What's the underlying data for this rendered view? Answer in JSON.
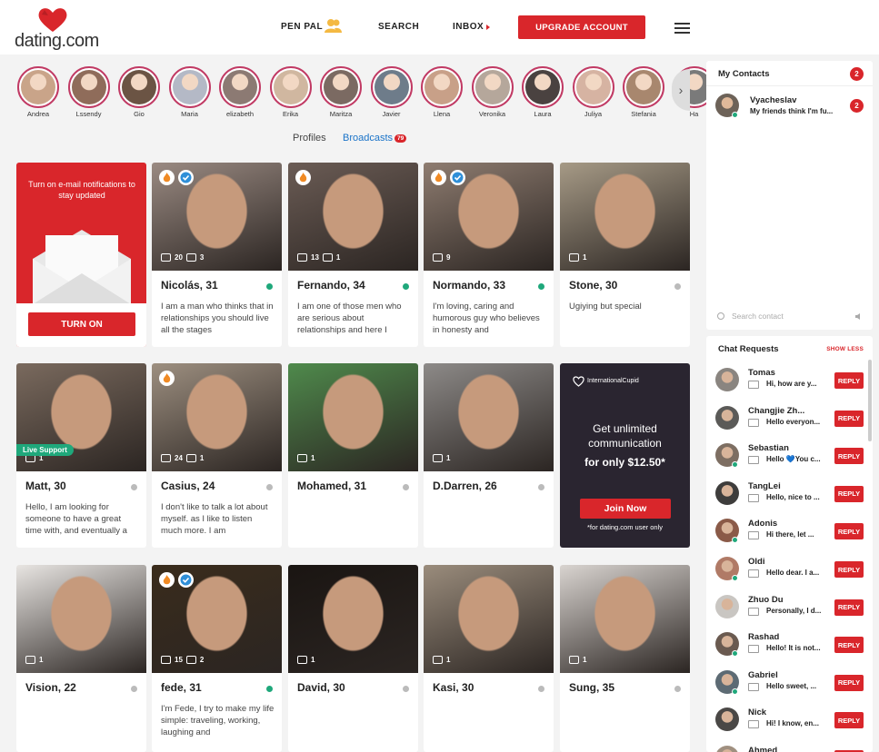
{
  "header": {
    "logo_text": "dating.com",
    "nav": {
      "penpal": "PEN PAL",
      "search": "SEARCH",
      "inbox": "INBOX"
    },
    "upgrade_label": "UPGRADE ACCOUNT"
  },
  "stories": [
    {
      "name": "Andrea",
      "color": "#c9a489"
    },
    {
      "name": "Lssendy",
      "color": "#8f6c5a"
    },
    {
      "name": "Gio",
      "color": "#6b5444"
    },
    {
      "name": "Maria",
      "color": "#b4b9c6"
    },
    {
      "name": "elizabeth",
      "color": "#8c7a73"
    },
    {
      "name": "Erika",
      "color": "#d0b7a0"
    },
    {
      "name": "Maritza",
      "color": "#7b6a62"
    },
    {
      "name": "Javier",
      "color": "#6e7c8a"
    },
    {
      "name": "Llena",
      "color": "#c8a088"
    },
    {
      "name": "Veronika",
      "color": "#b5a79b"
    },
    {
      "name": "Laura",
      "color": "#4a4240"
    },
    {
      "name": "Juliya",
      "color": "#d6b3a2"
    },
    {
      "name": "Stefania",
      "color": "#a8876e"
    },
    {
      "name": "Ha",
      "color": "#7a7a7a"
    }
  ],
  "tabs": {
    "profiles": "Profiles",
    "broadcasts": "Broadcasts",
    "broadcasts_count": "79"
  },
  "notify_card": {
    "text": "Turn on e-mail notifications to stay updated",
    "button": "TURN ON"
  },
  "promo_card": {
    "brand": "InternationalCupid",
    "line1": "Get unlimited communication",
    "line2": "for only $12.50*",
    "button": "Join Now",
    "footnote": "*for dating.com user only"
  },
  "live_support": "Live Support",
  "profiles": [
    {
      "name": "Nicolás, 31",
      "bio": "I am a man who thinks that in relationships you should live all the stages",
      "photos": "20",
      "videos": "3",
      "online": true,
      "fire": true,
      "verified": true,
      "color": "#9a8a82"
    },
    {
      "name": "Fernando, 34",
      "bio": "I am one of those men who are serious about relationships and here I",
      "photos": "13",
      "videos": "1",
      "online": true,
      "fire": true,
      "verified": false,
      "color": "#6b5c55"
    },
    {
      "name": "Normando, 33",
      "bio": "I'm loving, caring and humorous guy who believes in honesty and",
      "photos": "9",
      "videos": "",
      "online": true,
      "fire": true,
      "verified": true,
      "color": "#8e7c70"
    },
    {
      "name": "Stone, 30",
      "bio": "Ugiying but special",
      "photos": "1",
      "videos": "",
      "online": false,
      "fire": false,
      "verified": false,
      "color": "#a69a86"
    },
    {
      "name": "Matt, 30",
      "bio": "Hello, I am looking for someone to have a great time with, and eventually a",
      "photos": "1",
      "videos": "",
      "online": false,
      "fire": false,
      "verified": false,
      "color": "#7a6a5e"
    },
    {
      "name": "Casius, 24",
      "bio": "I don't like to talk a lot about myself. as I like to listen much more. I am",
      "photos": "24",
      "videos": "1",
      "online": false,
      "fire": true,
      "verified": false,
      "color": "#9d8f80"
    },
    {
      "name": "Mohamed, 31",
      "bio": "",
      "photos": "1",
      "videos": "",
      "online": false,
      "fire": false,
      "verified": false,
      "color": "#4f8a4c"
    },
    {
      "name": "D.Darren, 26",
      "bio": "",
      "photos": "1",
      "videos": "",
      "online": false,
      "fire": false,
      "verified": false,
      "color": "#8d8a88"
    },
    {
      "name": "Vision, 22",
      "bio": "",
      "photos": "1",
      "videos": "",
      "online": false,
      "fire": false,
      "verified": false,
      "color": "#e8e5e2"
    },
    {
      "name": "fede, 31",
      "bio": "I'm Fede, I try to make my life simple: traveling, working, laughing and",
      "photos": "15",
      "videos": "2",
      "online": true,
      "fire": true,
      "verified": true,
      "color": "#3a2c1c"
    },
    {
      "name": "David, 30",
      "bio": "",
      "photos": "1",
      "videos": "",
      "online": false,
      "fire": false,
      "verified": false,
      "color": "#1a1512"
    },
    {
      "name": "Kasi, 30",
      "bio": "",
      "photos": "1",
      "videos": "",
      "online": false,
      "fire": false,
      "verified": false,
      "color": "#9a8c7c"
    },
    {
      "name": "Sung, 35",
      "bio": "",
      "photos": "1",
      "videos": "",
      "online": false,
      "fire": false,
      "verified": false,
      "color": "#d9d4d0"
    }
  ],
  "contacts": {
    "title": "My Contacts",
    "count": "2",
    "items": [
      {
        "name": "Vyacheslav",
        "message": "My friends think I'm fu...",
        "unread": "2",
        "color": "#6d6258"
      }
    ],
    "search_placeholder": "Search contact"
  },
  "requests": {
    "title": "Chat Requests",
    "show_less": "SHOW LESS",
    "reply_label": "REPLY",
    "items": [
      {
        "name": "Tomas",
        "message": "Hi, how are y...",
        "color": "#8a8580",
        "online": false
      },
      {
        "name": "Changjie Zh...",
        "message": "Hello everyon...",
        "color": "#5b5a58",
        "online": false
      },
      {
        "name": "Sebastian",
        "message": "Hello 💙You c...",
        "color": "#7d6e62",
        "online": true
      },
      {
        "name": "TangLei",
        "message": "Hello, nice to ...",
        "color": "#3e3d3c",
        "online": false
      },
      {
        "name": "Adonis",
        "message": "Hi there, let ...",
        "color": "#8a5a48",
        "online": true
      },
      {
        "name": "Oldi",
        "message": "Hello dear. I a...",
        "color": "#b07a66",
        "online": true
      },
      {
        "name": "Zhuo Du",
        "message": "Personally, I d...",
        "color": "#c9c6c2",
        "online": false
      },
      {
        "name": "Rashad",
        "message": "Hello! It is not...",
        "color": "#6a5a50",
        "online": true
      },
      {
        "name": "Gabriel",
        "message": "Hello sweet, ...",
        "color": "#5d6b74",
        "online": true
      },
      {
        "name": "Nick",
        "message": "Hi! I know, en...",
        "color": "#4a4846",
        "online": false
      },
      {
        "name": "Ahmed",
        "message": "",
        "color": "#a09080",
        "online": false
      }
    ]
  },
  "colors": {
    "accent": "#d9262b",
    "online": "#1fa87b",
    "offline": "#bbbbbb",
    "link": "#1a73c8"
  }
}
